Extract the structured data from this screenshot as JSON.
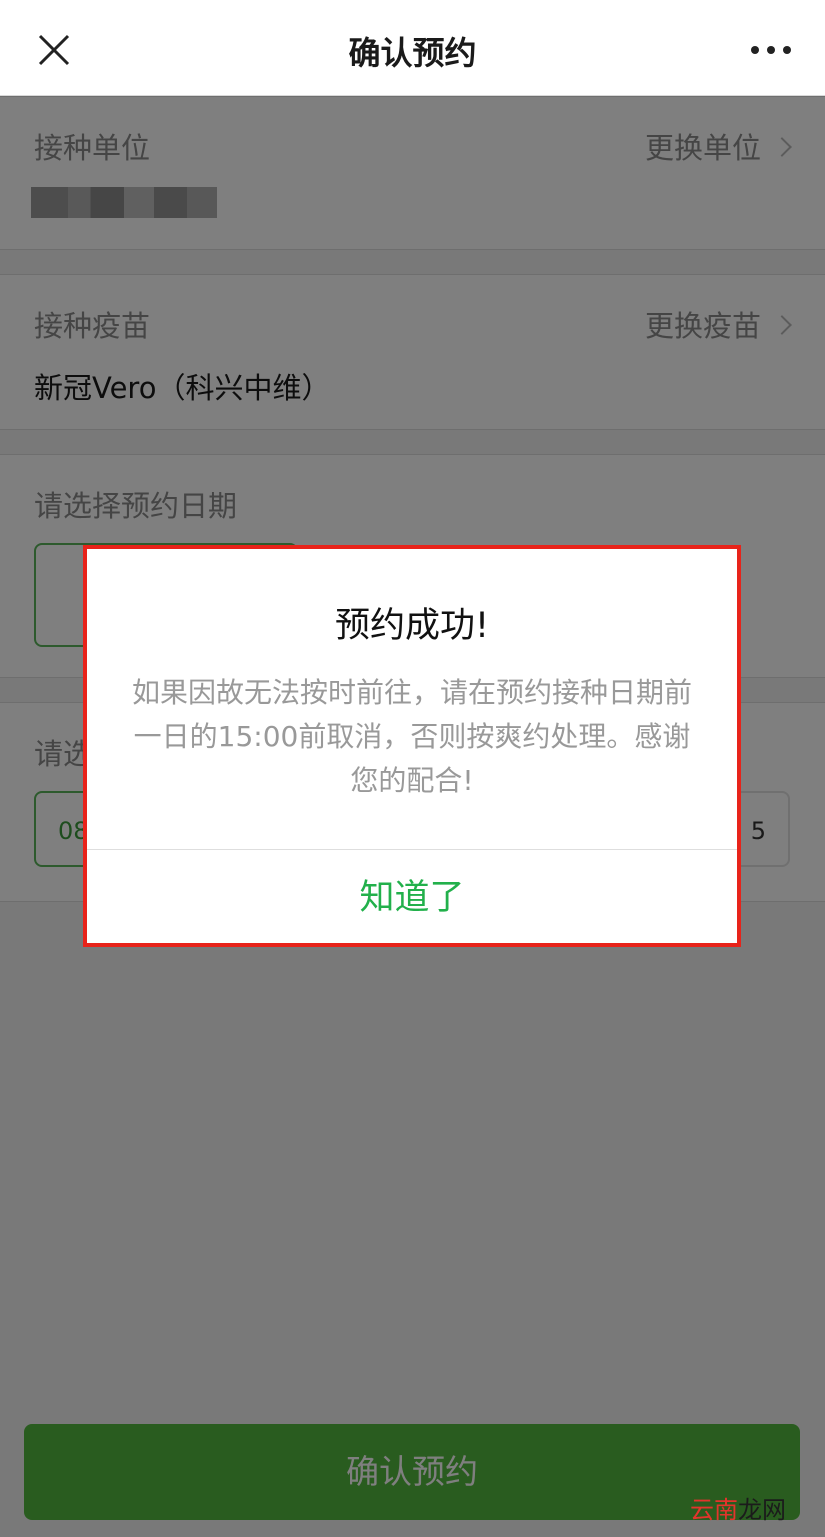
{
  "header": {
    "title": "确认预约"
  },
  "unit_section": {
    "label": "接种单位",
    "change_link": "更换单位"
  },
  "vaccine_section": {
    "label": "接种疫苗",
    "change_link": "更换疫苗",
    "value": "新冠Vero（科兴中维）"
  },
  "date_section": {
    "label": "请选择预约日期"
  },
  "time_section": {
    "label_visible": "请选",
    "slots": [
      "08",
      "5"
    ]
  },
  "footer": {
    "confirm_label": "确认预约"
  },
  "dialog": {
    "title": "预约成功!",
    "message": "如果因故无法按时前往，请在预约接种日期前一日的15:00前取消，否则按爽约处理。感谢您的配合!",
    "ok_label": "知道了"
  },
  "watermark": {
    "part1": "云南",
    "part2": "龙网"
  },
  "colors": {
    "accent_green": "#53b83f",
    "dialog_button_green": "#22b04b",
    "highlight_red": "#e8231a"
  }
}
